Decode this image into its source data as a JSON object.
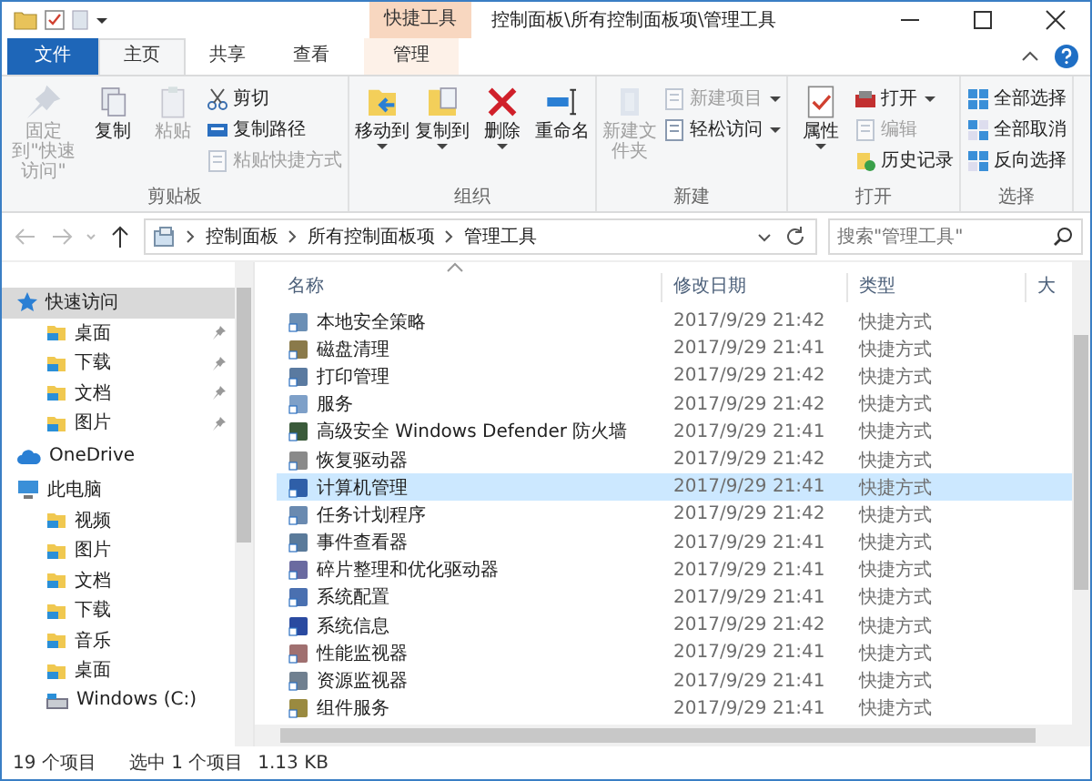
{
  "window": {
    "title": "控制面板\\所有控制面板项\\管理工具",
    "context_group": "快捷工具"
  },
  "ribbon_tabs": [
    {
      "label": "文件",
      "kind": "file",
      "selected": false
    },
    {
      "label": "主页",
      "kind": "normal",
      "selected": true
    },
    {
      "label": "共享",
      "kind": "normal",
      "selected": false
    },
    {
      "label": "查看",
      "kind": "normal",
      "selected": false
    },
    {
      "label": "管理",
      "kind": "context",
      "selected": false
    }
  ],
  "ribbon_groups": [
    {
      "label": "剪贴板",
      "items": [
        {
          "label": "固定到\"快速访问\"",
          "kind": "large",
          "disabled": true,
          "dropdown": false
        },
        {
          "label": "复制",
          "kind": "large",
          "disabled": false,
          "dropdown": false
        },
        {
          "label": "粘贴",
          "kind": "large",
          "disabled": true,
          "dropdown": false
        },
        {
          "label": "剪切",
          "kind": "small",
          "disabled": false,
          "dropdown": false
        },
        {
          "label": "复制路径",
          "kind": "small",
          "disabled": false,
          "dropdown": false
        },
        {
          "label": "粘贴快捷方式",
          "kind": "small",
          "disabled": true,
          "dropdown": false
        }
      ]
    },
    {
      "label": "组织",
      "items": [
        {
          "label": "移动到",
          "kind": "large",
          "disabled": false,
          "dropdown": true
        },
        {
          "label": "复制到",
          "kind": "large",
          "disabled": false,
          "dropdown": true
        },
        {
          "label": "删除",
          "kind": "large",
          "disabled": false,
          "dropdown": true
        },
        {
          "label": "重命名",
          "kind": "large",
          "disabled": false,
          "dropdown": false
        }
      ]
    },
    {
      "label": "新建",
      "items": [
        {
          "label": "新建文件夹",
          "kind": "large",
          "disabled": true,
          "dropdown": false
        },
        {
          "label": "新建项目",
          "kind": "small",
          "disabled": true,
          "dropdown": true
        },
        {
          "label": "轻松访问",
          "kind": "small",
          "disabled": false,
          "dropdown": true
        }
      ]
    },
    {
      "label": "打开",
      "items": [
        {
          "label": "属性",
          "kind": "large",
          "disabled": false,
          "dropdown": true
        },
        {
          "label": "打开",
          "kind": "small",
          "disabled": false,
          "dropdown": true
        },
        {
          "label": "编辑",
          "kind": "small",
          "disabled": true,
          "dropdown": false
        },
        {
          "label": "历史记录",
          "kind": "small",
          "disabled": false,
          "dropdown": false
        }
      ]
    },
    {
      "label": "选择",
      "items": [
        {
          "label": "全部选择",
          "kind": "small",
          "disabled": false,
          "dropdown": false
        },
        {
          "label": "全部取消",
          "kind": "small",
          "disabled": false,
          "dropdown": false
        },
        {
          "label": "反向选择",
          "kind": "small",
          "disabled": false,
          "dropdown": false
        }
      ]
    }
  ],
  "address_bar": {
    "path": [
      "控制面板",
      "所有控制面板项",
      "管理工具"
    ]
  },
  "search": {
    "placeholder": "搜索\"管理工具\""
  },
  "navigation": [
    {
      "label": "快速访问",
      "kind": "star",
      "selected": true,
      "children": [
        {
          "label": "桌面",
          "kind": "folder",
          "selected": false,
          "pinned": true
        },
        {
          "label": "下载",
          "kind": "folder",
          "selected": false,
          "pinned": true
        },
        {
          "label": "文档",
          "kind": "folder",
          "selected": false,
          "pinned": true
        },
        {
          "label": "图片",
          "kind": "folder",
          "selected": false,
          "pinned": true
        }
      ]
    },
    {
      "label": "OneDrive",
      "kind": "cloud",
      "selected": false
    },
    {
      "label": "此电脑",
      "kind": "computer",
      "selected": false,
      "children": [
        {
          "label": "视频",
          "kind": "folder",
          "selected": false,
          "pinned": false
        },
        {
          "label": "图片",
          "kind": "folder",
          "selected": false,
          "pinned": false
        },
        {
          "label": "文档",
          "kind": "folder",
          "selected": false,
          "pinned": false
        },
        {
          "label": "下载",
          "kind": "folder",
          "selected": false,
          "pinned": false
        },
        {
          "label": "音乐",
          "kind": "folder",
          "selected": false,
          "pinned": false
        },
        {
          "label": "桌面",
          "kind": "folder",
          "selected": false,
          "pinned": false
        },
        {
          "label": "Windows (C:)",
          "kind": "drive",
          "selected": false,
          "pinned": false
        }
      ]
    }
  ],
  "columns": [
    "名称",
    "修改日期",
    "类型",
    "大"
  ],
  "files": [
    {
      "name": "本地安全策略",
      "modified": "2017/9/29 21:42",
      "type": "快捷方式",
      "selected": false
    },
    {
      "name": "磁盘清理",
      "modified": "2017/9/29 21:41",
      "type": "快捷方式",
      "selected": false
    },
    {
      "name": "打印管理",
      "modified": "2017/9/29 21:42",
      "type": "快捷方式",
      "selected": false
    },
    {
      "name": "服务",
      "modified": "2017/9/29 21:42",
      "type": "快捷方式",
      "selected": false
    },
    {
      "name": "高级安全 Windows Defender 防火墙",
      "modified": "2017/9/29 21:41",
      "type": "快捷方式",
      "selected": false
    },
    {
      "name": "恢复驱动器",
      "modified": "2017/9/29 21:42",
      "type": "快捷方式",
      "selected": false
    },
    {
      "name": "计算机管理",
      "modified": "2017/9/29 21:41",
      "type": "快捷方式",
      "selected": true
    },
    {
      "name": "任务计划程序",
      "modified": "2017/9/29 21:42",
      "type": "快捷方式",
      "selected": false
    },
    {
      "name": "事件查看器",
      "modified": "2017/9/29 21:41",
      "type": "快捷方式",
      "selected": false
    },
    {
      "name": "碎片整理和优化驱动器",
      "modified": "2017/9/29 21:41",
      "type": "快捷方式",
      "selected": false
    },
    {
      "name": "系统配置",
      "modified": "2017/9/29 21:41",
      "type": "快捷方式",
      "selected": false
    },
    {
      "name": "系统信息",
      "modified": "2017/9/29 21:42",
      "type": "快捷方式",
      "selected": false
    },
    {
      "name": "性能监视器",
      "modified": "2017/9/29 21:41",
      "type": "快捷方式",
      "selected": false
    },
    {
      "name": "资源监视器",
      "modified": "2017/9/29 21:41",
      "type": "快捷方式",
      "selected": false
    },
    {
      "name": "组件服务",
      "modified": "2017/9/29 21:41",
      "type": "快捷方式",
      "selected": false
    }
  ],
  "status_bar": {
    "item_count": "19 个项目",
    "selection": "选中 1 个项目",
    "size": "1.13 KB"
  }
}
